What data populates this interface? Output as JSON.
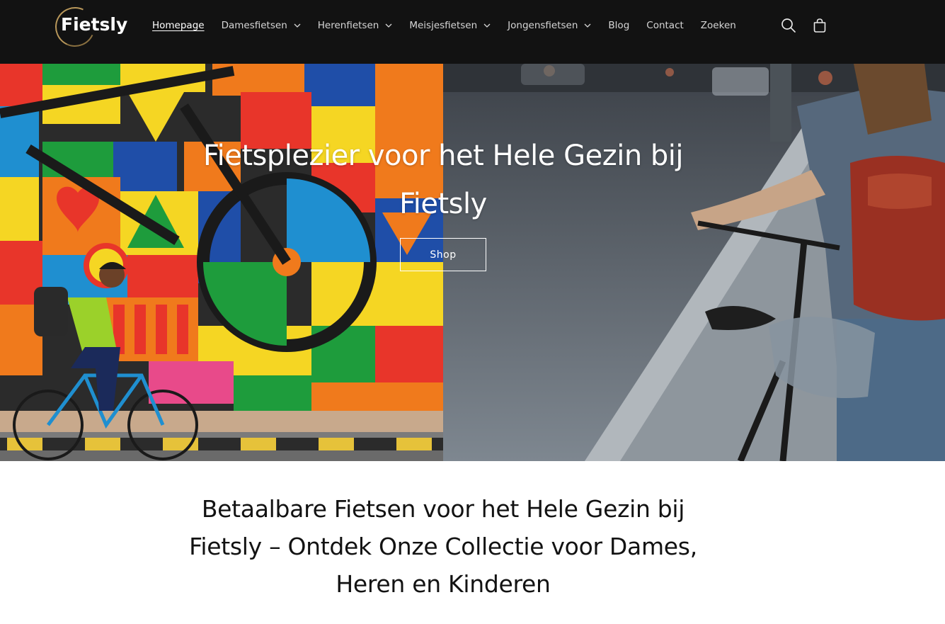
{
  "header": {
    "logo_text": "Fietsly",
    "nav": [
      {
        "label": "Homepage",
        "active": true,
        "has_dropdown": false
      },
      {
        "label": "Damesfietsen",
        "active": false,
        "has_dropdown": true
      },
      {
        "label": "Herenfietsen",
        "active": false,
        "has_dropdown": true
      },
      {
        "label": "Meisjesfietsen",
        "active": false,
        "has_dropdown": true
      },
      {
        "label": "Jongensfietsen",
        "active": false,
        "has_dropdown": true
      },
      {
        "label": "Blog",
        "active": false,
        "has_dropdown": false
      },
      {
        "label": "Contact",
        "active": false,
        "has_dropdown": false
      },
      {
        "label": "Zoeken",
        "active": false,
        "has_dropdown": false
      }
    ],
    "icons": [
      "search-icon",
      "cart-icon"
    ]
  },
  "hero": {
    "title": "Fietsplezier voor het Hele Gezin bij Fietsly",
    "button_label": "Shop"
  },
  "intro": {
    "title": "Betaalbare Fietsen voor het Hele Gezin bij Fietsly – Ontdek Onze Collectie voor Dames, Heren en Kinderen"
  },
  "colors": {
    "header_bg": "#121212",
    "logo_accent": "#b8975a",
    "text": "#121212"
  }
}
